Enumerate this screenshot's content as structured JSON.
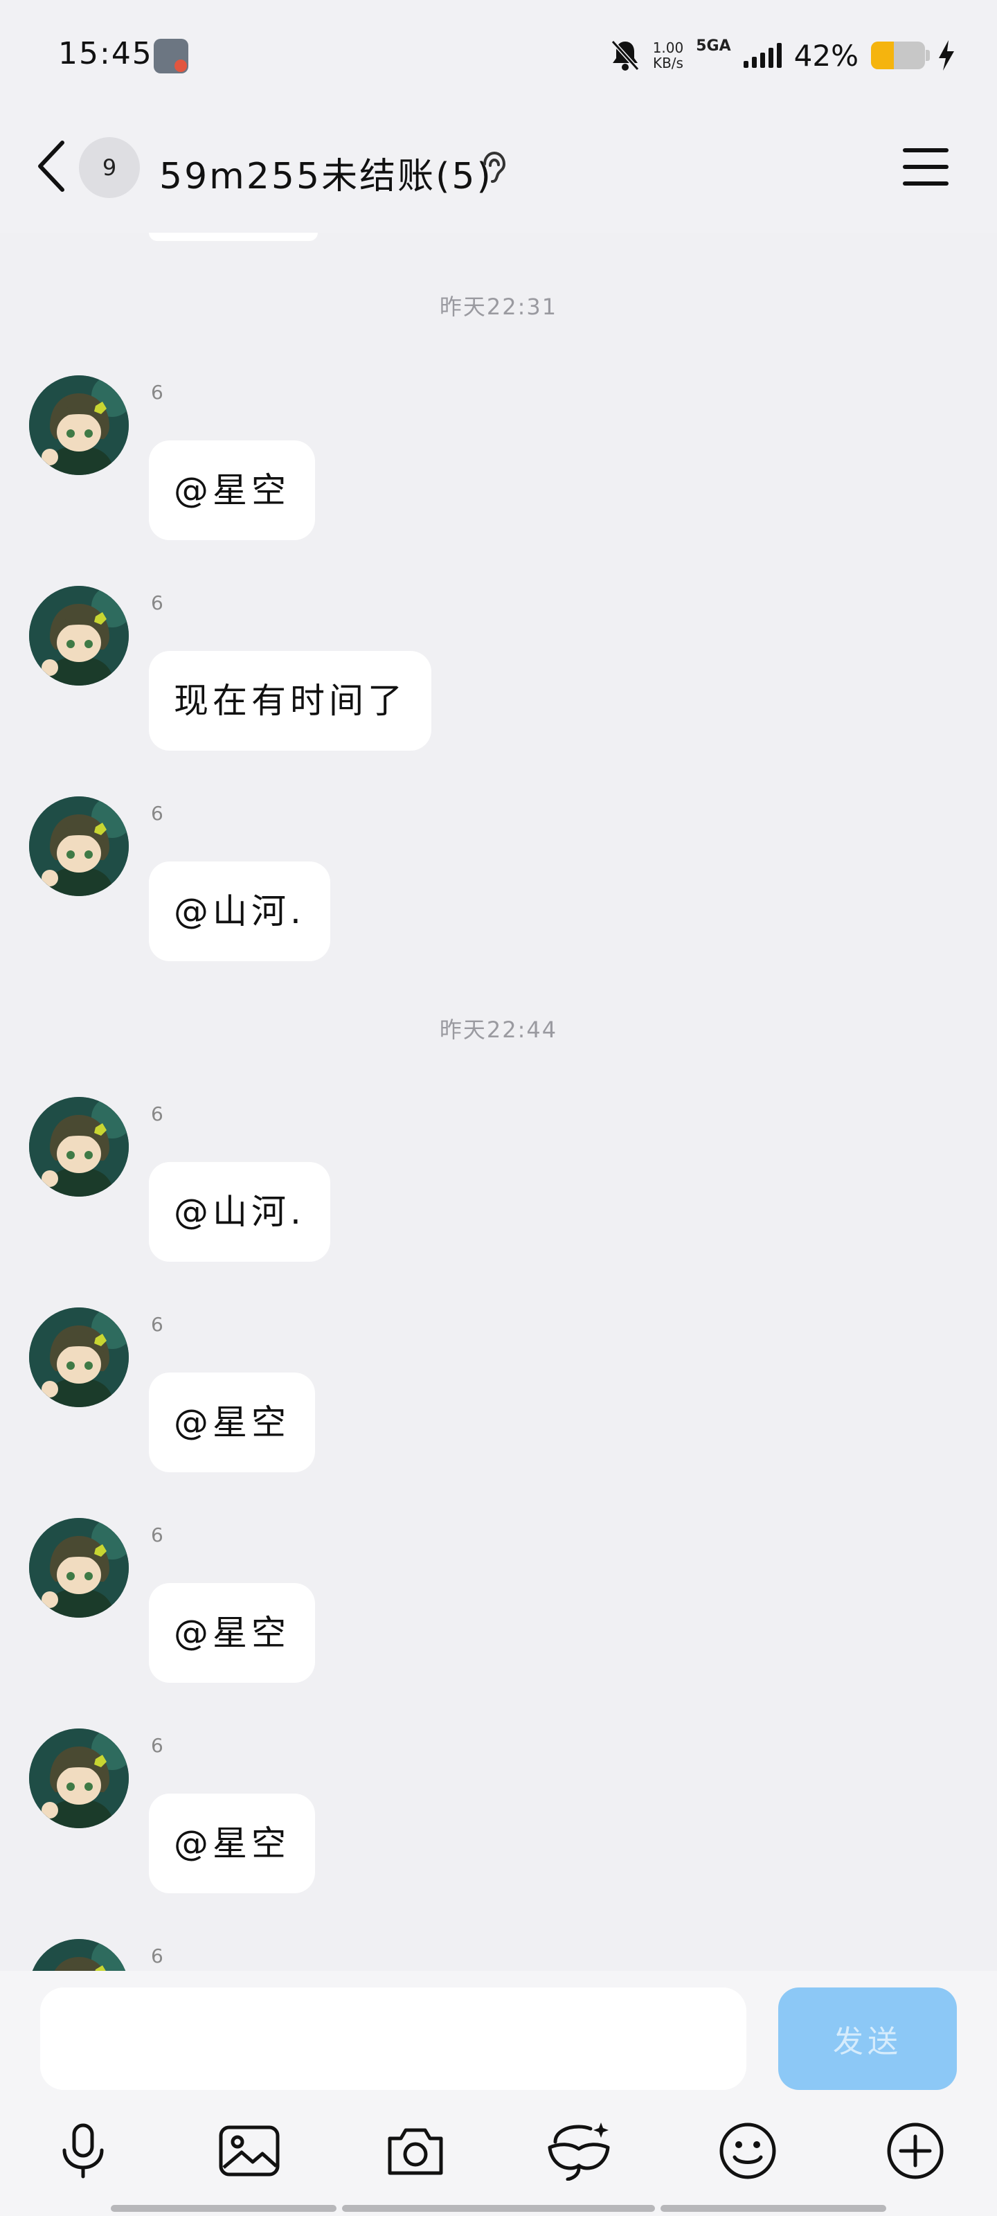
{
  "status_bar": {
    "time": "15:45",
    "speed_value": "1.00",
    "speed_unit": "KB/s",
    "network": "5GA",
    "battery_pct": "42%",
    "battery_level": 0.42,
    "icons": [
      "app-notification-icon",
      "bell-muted-icon",
      "signal-icon",
      "battery-icon",
      "charging-icon"
    ]
  },
  "header": {
    "unread_count": "9",
    "title": "59m255未结账(5)",
    "icons": [
      "back-arrow-icon",
      "ear-icon",
      "menu-icon"
    ]
  },
  "chat": {
    "timestamps": [
      "昨天22:31",
      "昨天22:44"
    ],
    "messages": [
      {
        "nick": "6",
        "text": "@星空"
      },
      {
        "nick": "6",
        "text": "现在有时间了"
      },
      {
        "nick": "6",
        "text": "@山河."
      },
      {
        "nick": "6",
        "text": "@山河."
      },
      {
        "nick": "6",
        "text": "@星空"
      },
      {
        "nick": "6",
        "text": "@星空"
      },
      {
        "nick": "6",
        "text": "@星空"
      },
      {
        "nick": "6",
        "text": ""
      }
    ]
  },
  "input": {
    "value": "",
    "placeholder": "",
    "send_label": "发送",
    "send_color": "#8cc8f6"
  },
  "toolbar": {
    "icons": [
      "microphone-icon",
      "image-icon",
      "camera-icon",
      "sticker-icon",
      "emoji-icon",
      "plus-icon"
    ]
  }
}
